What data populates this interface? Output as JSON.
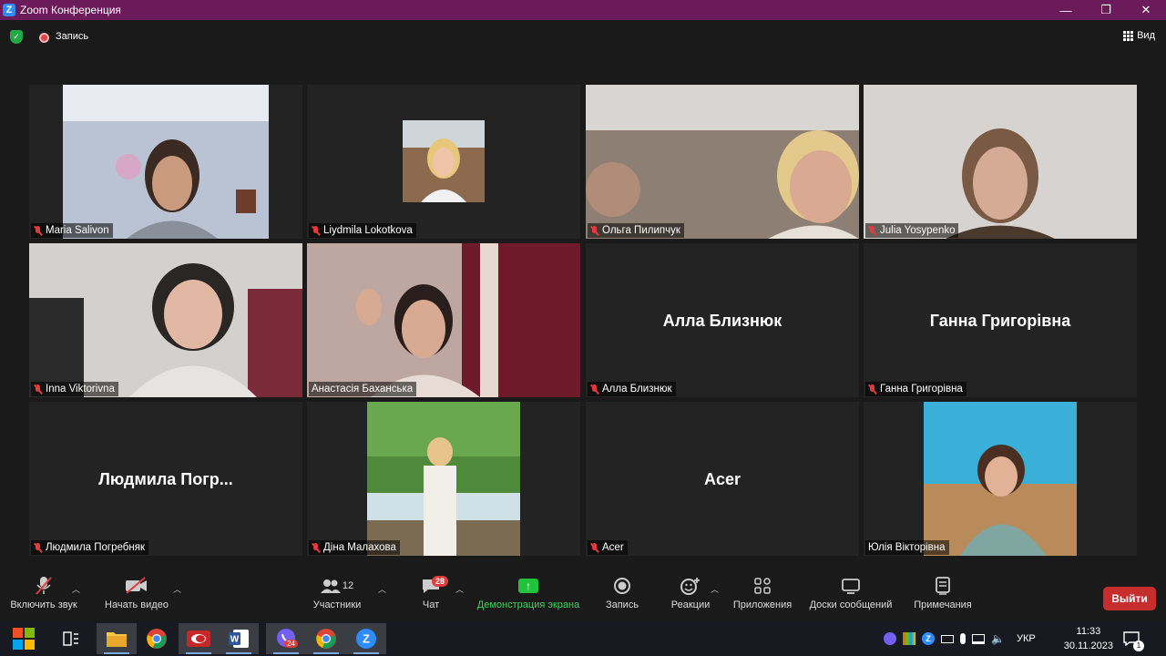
{
  "window": {
    "title": "Zoom Конференция",
    "minimize": "—",
    "maximize": "❐",
    "close": "✕"
  },
  "topbar": {
    "recording_label": "Запись",
    "view_label": "Вид"
  },
  "participants_tiles": [
    {
      "name": "Maria Salivon",
      "big_name": "",
      "video": true,
      "muted": true
    },
    {
      "name": "Liydmila Lokotkova",
      "big_name": "",
      "video": true,
      "muted": true
    },
    {
      "name": "Ольга Пилипчук",
      "big_name": "",
      "video": true,
      "muted": true
    },
    {
      "name": "Julia Yosypenko",
      "big_name": "",
      "video": true,
      "muted": true
    },
    {
      "name": "Inna Viktorivna",
      "big_name": "",
      "video": true,
      "muted": true
    },
    {
      "name": "Анастасія Баханська",
      "big_name": "",
      "video": true,
      "muted": false,
      "active": true
    },
    {
      "name": "Алла Близнюк",
      "big_name": "Алла Близнюк",
      "video": false,
      "muted": true
    },
    {
      "name": "Ганна Григорівна",
      "big_name": "Ганна Григорівна",
      "video": false,
      "muted": true
    },
    {
      "name": "Людмила Погребняк",
      "big_name": "Людмила  Погр...",
      "video": false,
      "muted": true
    },
    {
      "name": "Діна Малахова",
      "big_name": "",
      "video": true,
      "muted": true
    },
    {
      "name": "Acer",
      "big_name": "Acer",
      "video": false,
      "muted": true
    },
    {
      "name": "Юлія Вікторівна",
      "big_name": "",
      "video": true,
      "muted": false
    }
  ],
  "toolbar": {
    "unmute_label": "Включить звук",
    "start_video_label": "Начать видео",
    "participants_label": "Участники",
    "participants_count": "12",
    "chat_label": "Чат",
    "chat_badge": "28",
    "share_label": "Демонстрация экрана",
    "record_label": "Запись",
    "reactions_label": "Реакции",
    "apps_label": "Приложения",
    "whiteboards_label": "Доски сообщений",
    "notes_label": "Примечания",
    "leave_label": "Выйти"
  },
  "taskbar": {
    "lang": "УКР",
    "time": "11:33",
    "date": "30.11.2023",
    "viber_badge": "24",
    "notif_count": "1"
  },
  "colors": {
    "title_bg": "#6b1a5a",
    "leave": "#c82d2d",
    "share": "#22c33c",
    "active_speaker": "#e8e07a",
    "muted": "#e23b3b"
  }
}
